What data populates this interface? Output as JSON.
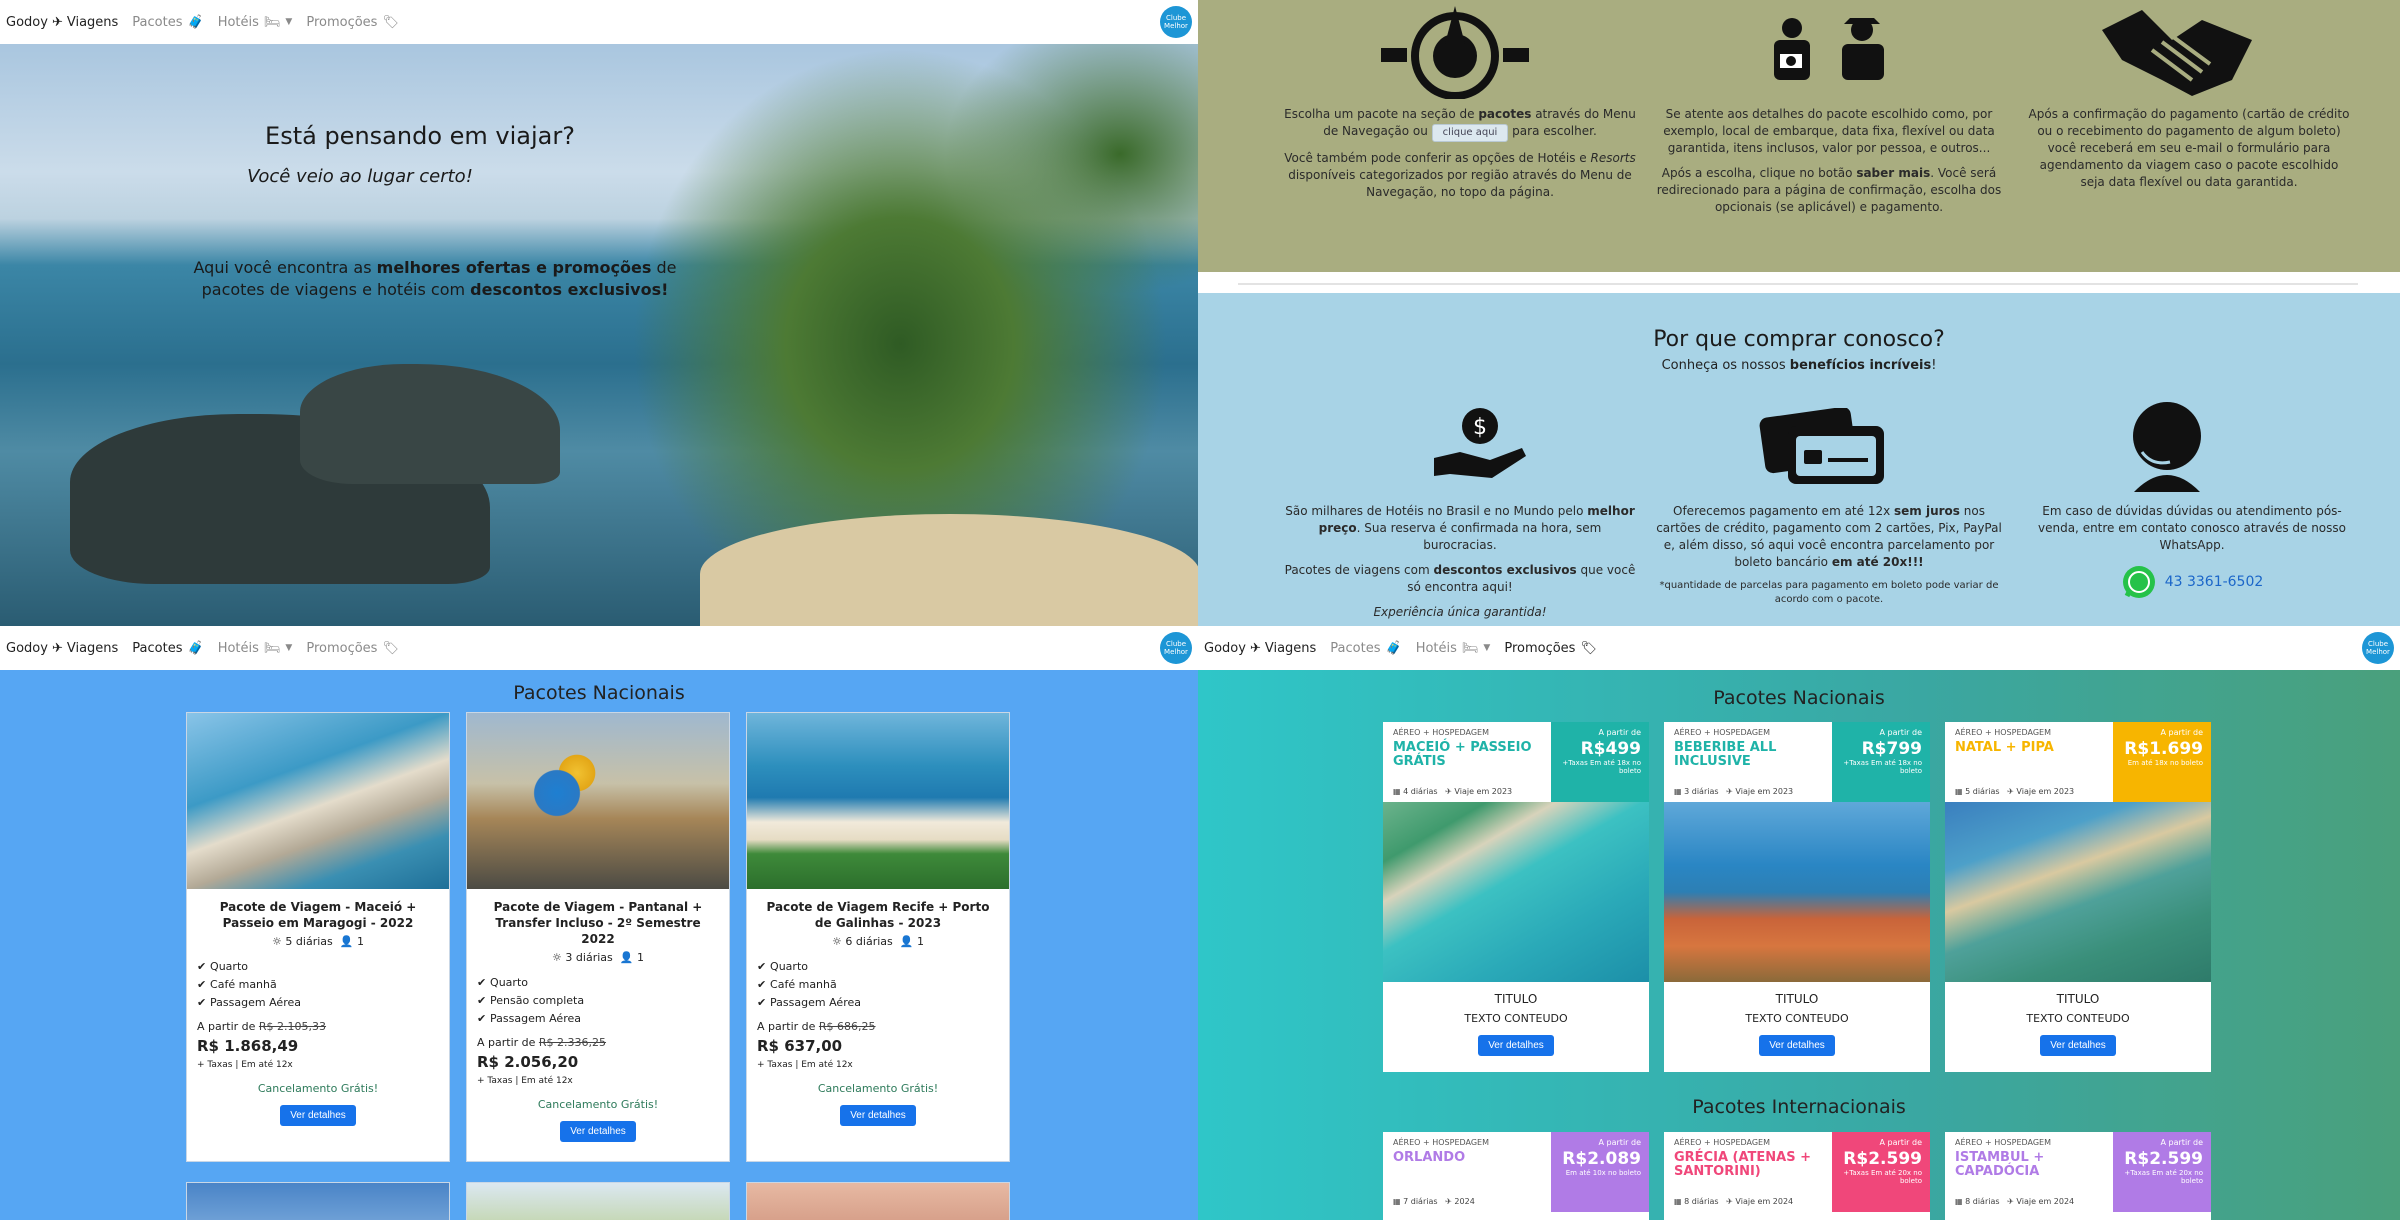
{
  "nav": {
    "brand": "Godoy",
    "brand2": "Viagens",
    "pacotes": "Pacotes",
    "hoteis": "Hotéis",
    "promocoes": "Promoções",
    "avatar": "Clube Melhor"
  },
  "hero": {
    "title": "Está pensando em viajar?",
    "subtitle": "Você veio ao lugar certo!",
    "body_1": "Aqui você encontra as ",
    "body_b1": "melhores ofertas e promoções",
    "body_2": " de pacotes de viagens e hotéis com ",
    "body_b2": "descontos exclusivos!"
  },
  "steps": [
    {
      "t1": "Escolha um pacote na seção de ",
      "b1": "pacotes",
      "t2": " através do Menu de Navegação ou ",
      "button": "clique aqui",
      "t3": " para escolher.",
      "t4": "Você também pode conferir as opções de Hotéis e ",
      "i1": "Resorts",
      "t5": " disponíveis categorizados por região através do Menu de Navegação, no topo da página."
    },
    {
      "t1": "Se atente aos detalhes do pacote escolhido como, por exemplo, local de embarque, data fixa, flexível ou data garantida, itens inclusos, valor por pessoa, e outros...",
      "t2": "Após a escolha, clique no botão ",
      "b1": "saber mais",
      "t3": ". Você será redirecionado para a página de confirmação, escolha dos opcionais (se aplicável) e pagamento."
    },
    {
      "t1": "Após a confirmação do pagamento (cartão de crédito ou o recebimento do pagamento de algum boleto) você receberá em seu e-mail o formulário para agendamento da viagem caso o pacote escolhido seja data flexível ou data garantida."
    }
  ],
  "why": {
    "title": "Por que comprar conosco?",
    "sub_1": "Conheça os nossos ",
    "sub_b": "benefícios incríveis",
    "sub_2": "!",
    "c1_1": "São milhares de Hotéis no Brasil e no Mundo pelo ",
    "c1_b": "melhor preço",
    "c1_2": ". Sua reserva é confirmada na hora, sem burocracias.",
    "c1_3": "Pacotes de viagens com ",
    "c1_b2": "descontos exclusivos",
    "c1_4": " que você só encontra aqui!",
    "c1_5": "Experiência única garantida!",
    "c2_1": "Oferecemos pagamento em até 12x ",
    "c2_b": "sem juros",
    "c2_2": " nos cartões de crédito, pagamento com 2 cartões, Pix, PayPal e, além disso, só aqui você encontra parcelamento por boleto bancário ",
    "c2_b2": "em até 20x!!!",
    "c2_note": "*quantidade de parcelas para pagamento em boleto pode variar de acordo com o pacote.",
    "c3": "Em caso de dúvidas dúvidas ou atendimento pós-venda, entre em contato conosco através de nosso WhatsApp.",
    "phone": "43 3361-6502"
  },
  "q3": {
    "section_title": "Pacotes Nacionais",
    "cards": [
      {
        "title": "Pacote de Viagem - Maceió + Passeio em Maragogi - 2022",
        "nights": "5 diárias",
        "people": "1",
        "items": [
          "Quarto",
          "Café manhã",
          "Passagem Aérea"
        ],
        "from": "A partir de ",
        "old": "R$ 2.105,33",
        "price": "R$ 1.868,49",
        "tax": "+ Taxas | Em até 12x",
        "cancel": "Cancelamento Grátis!",
        "button": "Ver detalhes"
      },
      {
        "title": "Pacote de Viagem - Pantanal + Transfer Incluso - 2º Semestre 2022",
        "nights": "3 diárias",
        "people": "1",
        "items": [
          "Quarto",
          "Pensão completa",
          "Passagem Aérea"
        ],
        "from": "A partir de ",
        "old": "R$ 2.336,25",
        "price": "R$ 2.056,20",
        "tax": "+ Taxas | Em até 12x",
        "cancel": "Cancelamento Grátis!",
        "button": "Ver detalhes"
      },
      {
        "title": "Pacote de Viagem Recife + Porto de Galinhas - 2023",
        "nights": "6 diárias",
        "people": "1",
        "items": [
          "Quarto",
          "Café manhã",
          "Passagem Aérea"
        ],
        "from": "A partir de ",
        "old": "R$ 686,25",
        "price": "R$ 637,00",
        "tax": "+ Taxas | Em até 12x",
        "cancel": "Cancelamento Grátis!",
        "button": "Ver detalhes"
      }
    ]
  },
  "q4": {
    "national_title": "Pacotes Nacionais",
    "international_title": "Pacotes Internacionais",
    "national": [
      {
        "kicker": "AÉREO + HOSPEDAGEM",
        "dest": "MACEIÓ + PASSEIO GRÁTIS",
        "info1": "4 diárias",
        "info2": "Viaje em 2023",
        "ap": "A partir de",
        "price": "R$499",
        "note": "+Taxas Em até 18x no boleto",
        "color": "#1fb3a8",
        "titulo": "TITULO",
        "texto": "TEXTO CONTEUDO",
        "button": "Ver detalhes"
      },
      {
        "kicker": "AÉREO + HOSPEDAGEM",
        "dest": "BEBERIBE ALL INCLUSIVE",
        "info1": "3 diárias",
        "info2": "Viaje em 2023",
        "ap": "A partir de",
        "price": "R$799",
        "note": "+Taxas Em até 18x no boleto",
        "color": "#1fb3a8",
        "titulo": "TITULO",
        "texto": "TEXTO CONTEUDO",
        "button": "Ver detalhes"
      },
      {
        "kicker": "AÉREO + HOSPEDAGEM",
        "dest": "NATAL + PIPA",
        "info1": "5 diárias",
        "info2": "Viaje em 2023",
        "ap": "A partir de",
        "price": "R$1.699",
        "note": "Em até 18x no boleto",
        "color": "#f7b500",
        "titulo": "TITULO",
        "texto": "TEXTO CONTEUDO",
        "button": "Ver detalhes"
      }
    ],
    "international": [
      {
        "kicker": "AÉREO + HOSPEDAGEM",
        "dest": "ORLANDO",
        "info1": "7 diárias",
        "info2": "2024",
        "ap": "A partir de",
        "price": "R$2.089",
        "note": "Em até 10x no boleto",
        "color": "#b07be6"
      },
      {
        "kicker": "AÉREO + HOSPEDAGEM",
        "dest": "GRÉCIA (ATENAS + SANTORINI)",
        "info1": "8 diárias",
        "info2": "Viaje em 2024",
        "ap": "A partir de",
        "price": "R$2.599",
        "note": "+Taxas Em até 20x no boleto",
        "color": "#f0477a"
      },
      {
        "kicker": "AÉREO + HOSPEDAGEM",
        "dest": "ISTAMBUL + CAPADÓCIA",
        "info1": "8 diárias",
        "info2": "Viaje em 2024",
        "ap": "A partir de",
        "price": "R$2.599",
        "note": "+Taxas Em até 20x no boleto",
        "color": "#b07be6"
      }
    ]
  },
  "colors": {
    "nav_bg": "#ffffff",
    "q2_top": "#a9ad80",
    "q2_bottom": "#a8d3e6",
    "q3_bg": "#56a6f3",
    "button": "#1672ea",
    "whatsapp": "#25c249"
  }
}
